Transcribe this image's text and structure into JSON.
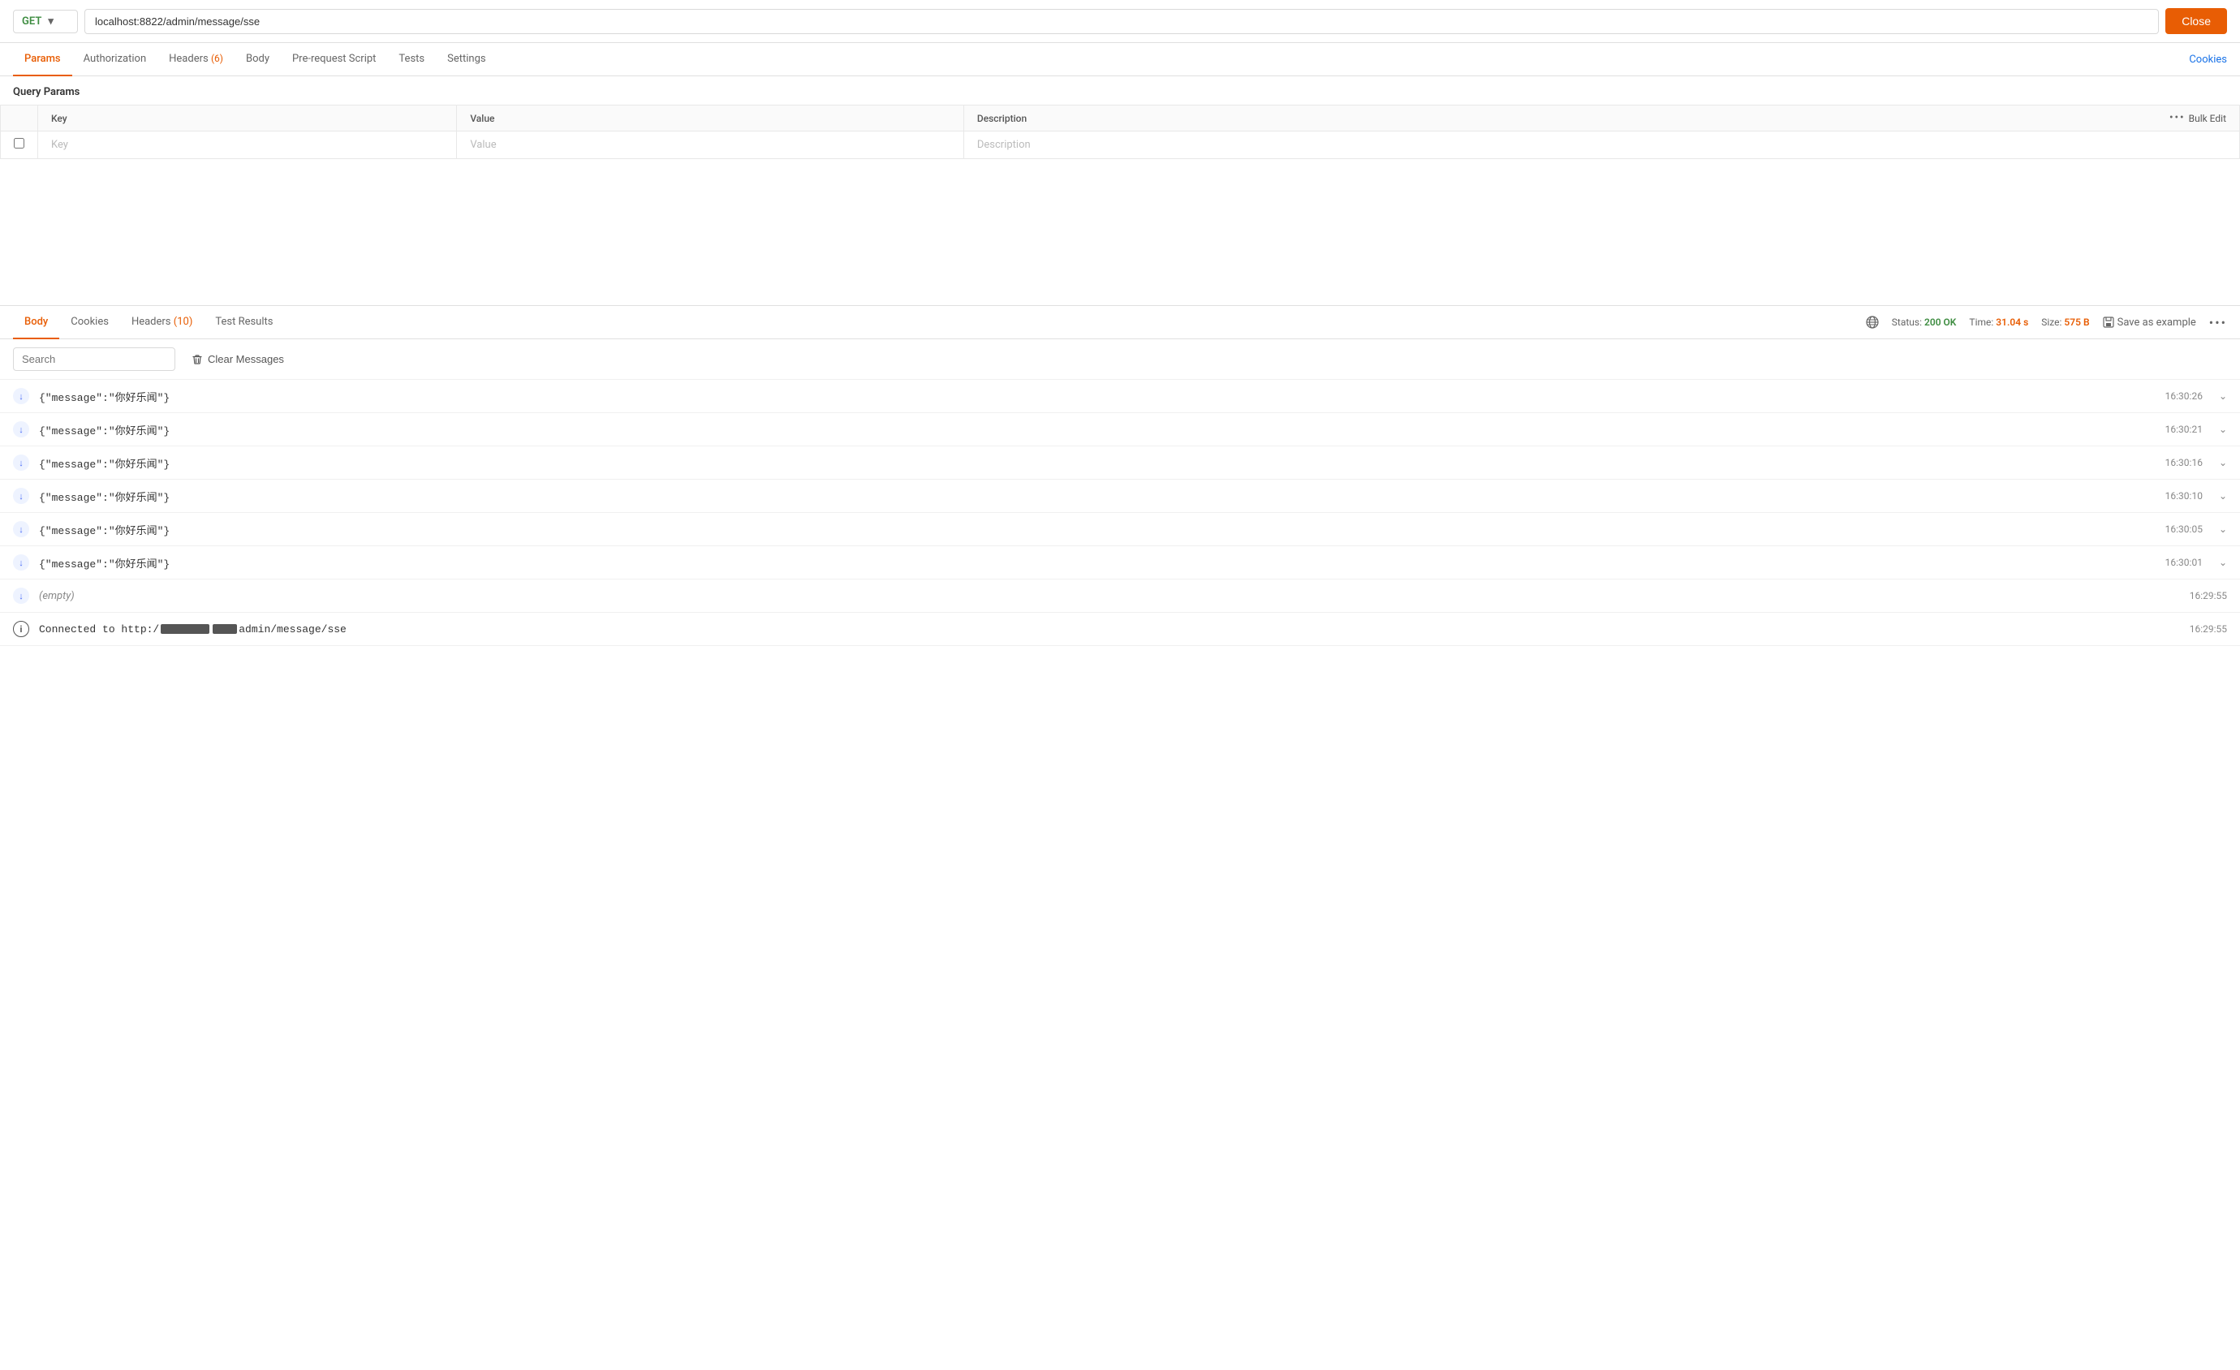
{
  "topbar": {
    "method": "GET",
    "url": "localhost:8822/admin/message/sse",
    "close_label": "Close"
  },
  "request_tabs": [
    {
      "id": "params",
      "label": "Params",
      "active": true,
      "badge": null
    },
    {
      "id": "authorization",
      "label": "Authorization",
      "active": false,
      "badge": null
    },
    {
      "id": "headers",
      "label": "Headers",
      "active": false,
      "badge": "(6)"
    },
    {
      "id": "body",
      "label": "Body",
      "active": false,
      "badge": null
    },
    {
      "id": "prerequest",
      "label": "Pre-request Script",
      "active": false,
      "badge": null
    },
    {
      "id": "tests",
      "label": "Tests",
      "active": false,
      "badge": null
    },
    {
      "id": "settings",
      "label": "Settings",
      "active": false,
      "badge": null
    }
  ],
  "cookies_link": "Cookies",
  "query_params": {
    "title": "Query Params",
    "columns": [
      "Key",
      "Value",
      "Description"
    ],
    "bulk_edit_label": "Bulk Edit",
    "placeholder_row": {
      "key": "Key",
      "value": "Value",
      "description": "Description"
    }
  },
  "response_tabs": [
    {
      "id": "body",
      "label": "Body",
      "active": true,
      "badge": null
    },
    {
      "id": "cookies",
      "label": "Cookies",
      "active": false,
      "badge": null
    },
    {
      "id": "headers",
      "label": "Headers",
      "active": false,
      "badge": "(10)"
    },
    {
      "id": "test_results",
      "label": "Test Results",
      "active": false,
      "badge": null
    }
  ],
  "response_meta": {
    "status_label": "Status:",
    "status_value": "200 OK",
    "time_label": "Time:",
    "time_value": "31.04 s",
    "size_label": "Size:",
    "size_value": "575 B",
    "save_example": "Save as example"
  },
  "sse_controls": {
    "search_placeholder": "Search",
    "clear_label": "Clear Messages"
  },
  "messages": [
    {
      "type": "data",
      "content": "{\"message\":\"你好乐闻\"}",
      "time": "16:30:26"
    },
    {
      "type": "data",
      "content": "{\"message\":\"你好乐闻\"}",
      "time": "16:30:21"
    },
    {
      "type": "data",
      "content": "{\"message\":\"你好乐闻\"}",
      "time": "16:30:16"
    },
    {
      "type": "data",
      "content": "{\"message\":\"你好乐闻\"}",
      "time": "16:30:10"
    },
    {
      "type": "data",
      "content": "{\"message\":\"你好乐闻\"}",
      "time": "16:30:05"
    },
    {
      "type": "data",
      "content": "{\"message\":\"你好乐闻\"}",
      "time": "16:30:01"
    },
    {
      "type": "empty",
      "content": "(empty)",
      "time": "16:29:55"
    },
    {
      "type": "info",
      "content": "Connected to http://",
      "time": "16:29:55"
    }
  ]
}
